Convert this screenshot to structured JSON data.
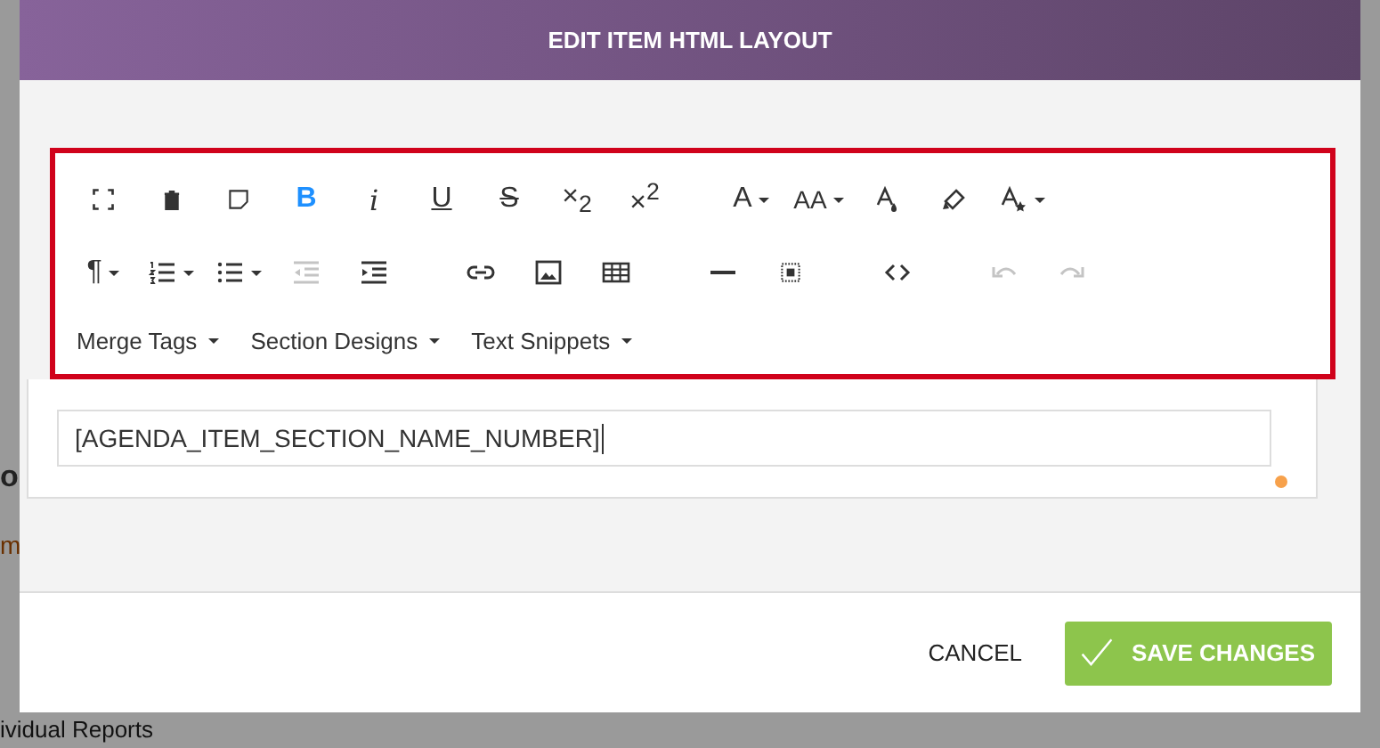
{
  "background": {
    "fragments": [
      "o",
      "m",
      "ividual Reports"
    ]
  },
  "modal": {
    "title": "EDIT ITEM HTML LAYOUT",
    "toolbar": {
      "rows": [
        [
          [
            {
              "kind": "fullscreen",
              "active": false,
              "disabled": false,
              "dropdown": false
            },
            {
              "kind": "trash",
              "active": false,
              "disabled": false,
              "dropdown": false
            },
            {
              "kind": "note",
              "active": false,
              "disabled": false,
              "dropdown": false
            },
            {
              "kind": "bold",
              "glyph": "B",
              "active": true,
              "disabled": false,
              "dropdown": false
            },
            {
              "kind": "italic",
              "glyph": "i",
              "active": false,
              "disabled": false,
              "dropdown": false
            },
            {
              "kind": "underline",
              "glyph": "U",
              "active": false,
              "disabled": false,
              "dropdown": false
            },
            {
              "kind": "strike",
              "glyph": "S",
              "active": false,
              "disabled": false,
              "dropdown": false
            },
            {
              "kind": "subscript",
              "glyph": "×$_{2}$",
              "active": false,
              "disabled": false,
              "dropdown": false
            },
            {
              "kind": "superscript",
              "glyph": "×$^{2}$",
              "active": false,
              "disabled": false,
              "dropdown": false
            }
          ],
          [
            {
              "kind": "font-family",
              "glyph": "A",
              "active": false,
              "disabled": false,
              "dropdown": true
            },
            {
              "kind": "font-size",
              "glyph": "AA",
              "active": false,
              "disabled": false,
              "dropdown": true
            },
            {
              "kind": "font-color",
              "active": false,
              "disabled": false,
              "dropdown": false
            },
            {
              "kind": "highlighter",
              "active": false,
              "disabled": false,
              "dropdown": false
            },
            {
              "kind": "font-style",
              "active": false,
              "disabled": false,
              "dropdown": true
            }
          ]
        ],
        [
          [
            {
              "kind": "paragraph",
              "glyph": "¶",
              "active": false,
              "disabled": false,
              "dropdown": true
            },
            {
              "kind": "ordered-list",
              "active": false,
              "disabled": false,
              "dropdown": true
            },
            {
              "kind": "bullet-list",
              "active": false,
              "disabled": false,
              "dropdown": true
            },
            {
              "kind": "outdent",
              "active": false,
              "disabled": true,
              "dropdown": false
            },
            {
              "kind": "indent",
              "active": false,
              "disabled": false,
              "dropdown": false
            }
          ],
          [
            {
              "kind": "link",
              "active": false,
              "disabled": false,
              "dropdown": false
            },
            {
              "kind": "image",
              "active": false,
              "disabled": false,
              "dropdown": false
            },
            {
              "kind": "table",
              "active": false,
              "disabled": false,
              "dropdown": false
            }
          ],
          [
            {
              "kind": "rule",
              "active": false,
              "disabled": false,
              "dropdown": false
            },
            {
              "kind": "select-all",
              "active": false,
              "disabled": false,
              "dropdown": false
            }
          ],
          [
            {
              "kind": "code",
              "active": false,
              "disabled": false,
              "dropdown": false
            }
          ],
          [
            {
              "kind": "undo",
              "active": false,
              "disabled": true,
              "dropdown": false
            },
            {
              "kind": "redo",
              "active": false,
              "disabled": true,
              "dropdown": false
            }
          ]
        ]
      ],
      "menus": [
        {
          "label": "Merge Tags"
        },
        {
          "label": "Section Designs"
        },
        {
          "label": "Text Snippets"
        }
      ]
    },
    "editor": {
      "value": "[AGENDA_ITEM_SECTION_NAME_NUMBER]"
    },
    "buttons": [
      {
        "kind": "cancel",
        "label": "CANCEL"
      },
      {
        "kind": "save",
        "label": "SAVE CHANGES"
      }
    ]
  }
}
